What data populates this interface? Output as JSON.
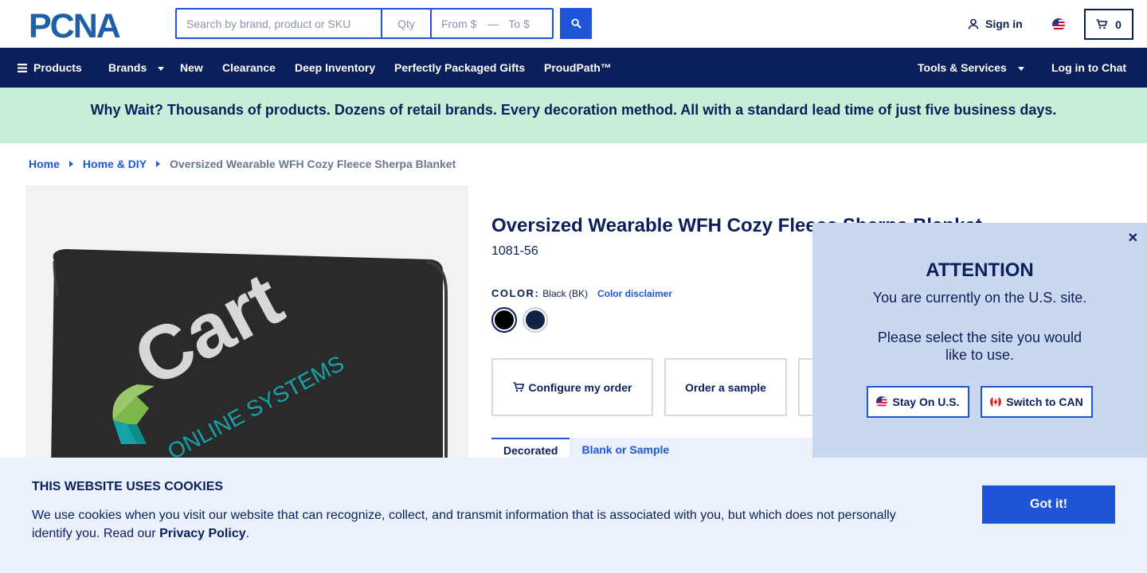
{
  "header": {
    "logo_text": "PCNA",
    "search": {
      "placeholder": "Search by brand, product or SKU",
      "qty_placeholder": "Qty",
      "from_placeholder": "From $",
      "to_placeholder": "To $"
    },
    "sign_in_label": "Sign in",
    "cart_count": "0",
    "region_flag": "us-flag-icon"
  },
  "nav": {
    "products": "Products",
    "brands": "Brands",
    "new": "New",
    "clearance": "Clearance",
    "deep_inventory": "Deep Inventory",
    "perfectly_packaged": "Perfectly Packaged Gifts",
    "proudpath": "ProudPath™",
    "tools_services": "Tools & Services",
    "chat": "Log in to Chat"
  },
  "banner": {
    "text": "Why Wait? Thousands of products. Dozens of retail brands. Every decoration method. All with a standard lead time of just five business days."
  },
  "breadcrumb": {
    "home": "Home",
    "category": "Home & DIY",
    "current": "Oversized Wearable WFH Cozy Fleece Sherpa Blanket"
  },
  "product": {
    "title": "Oversized Wearable WFH Cozy Fleece Sherpa Blanket",
    "sku": "1081-56",
    "color_label": "COLOR:",
    "color_value": "Black (BK)",
    "color_disclaimer": "Color disclaimer",
    "swatches": [
      {
        "name": "Black",
        "hex": "#000000"
      },
      {
        "name": "Navy",
        "hex": "#0f2444"
      }
    ],
    "image_text": {
      "logo_word": "Cart",
      "logo_tagline": "ONLINE SYSTEMS"
    },
    "actions": {
      "configure": "Configure my order",
      "sample": "Order a sample"
    },
    "tabs": {
      "decorated": "Decorated",
      "blank": "Blank or Sample"
    }
  },
  "region_popup": {
    "title": "ATTENTION",
    "message": "You are currently on the U.S. site.",
    "prompt": "Please select the site you would like to use.",
    "stay_label": "Stay On U.S.",
    "switch_label": "Switch to CAN"
  },
  "cookie": {
    "title": "THIS WEBSITE USES COOKIES",
    "text": "We use cookies when you visit our website that can recognize, collect, and transmit information that is associated with you, but which does not personally identify you. Read our ",
    "link": "Privacy Policy",
    "end": ".",
    "button": "Got it!"
  },
  "colors": {
    "navy": "#0b1f5c",
    "brand_blue": "#1e55d8",
    "banner_green": "#c5efd6",
    "popup_bg": "#c9d8ef",
    "cookie_bg": "#eaf1fb"
  }
}
